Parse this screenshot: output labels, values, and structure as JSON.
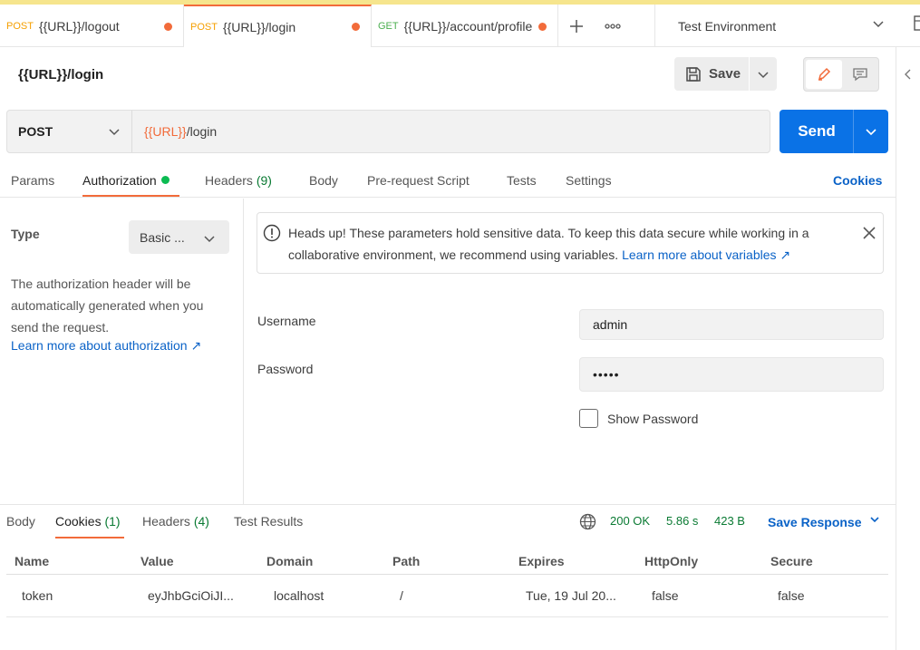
{
  "tabs": [
    {
      "method": "POST",
      "title": "{{URL}}/logout",
      "active": false
    },
    {
      "method": "POST",
      "title": "{{URL}}/login",
      "active": true
    },
    {
      "method": "GET",
      "title": "{{URL}}/account/profile",
      "active": false
    }
  ],
  "tab_add_icon": "plus-icon",
  "tab_more_icon": "ellipsis-icon",
  "environment": {
    "selected": "Test Environment"
  },
  "request": {
    "title": "{{URL}}/login",
    "save_label": "Save",
    "method": "POST",
    "url_var": "{{URL}}",
    "url_path": "/login",
    "send_label": "Send"
  },
  "req_tabs": {
    "params": "Params",
    "authorization": "Authorization",
    "headers": "Headers",
    "headers_count": "(9)",
    "body": "Body",
    "prerequest": "Pre-request Script",
    "tests": "Tests",
    "settings": "Settings",
    "cookies": "Cookies"
  },
  "auth": {
    "type_label": "Type",
    "type_value": "Basic ...",
    "description": "The authorization header will be automatically generated when you send the request.",
    "learn_more": "Learn more about authorization ↗",
    "alert_text": "Heads up! These parameters hold sensitive data. To keep this data secure while working in a collaborative environment, we recommend using variables.",
    "alert_link": "Learn more about variables ↗",
    "username_label": "Username",
    "username_value": "admin",
    "password_label": "Password",
    "password_value": "•••••",
    "show_password": "Show Password"
  },
  "response": {
    "tabs": {
      "body": "Body",
      "cookies": "Cookies",
      "cookies_count": "(1)",
      "headers": "Headers",
      "headers_count": "(4)",
      "tests": "Test Results"
    },
    "status": "200 OK",
    "time": "5.86 s",
    "size": "423 B",
    "save_response": "Save Response",
    "columns": [
      "Name",
      "Value",
      "Domain",
      "Path",
      "Expires",
      "HttpOnly",
      "Secure"
    ],
    "rows": [
      [
        "token",
        "eyJhbGciOiJI...",
        "localhost",
        "/",
        "Tue, 19 Jul 20...",
        "false",
        "false"
      ]
    ]
  },
  "colors": {
    "accent": "#f26b3a",
    "send": "#0a72e6",
    "link": "#0a62c7",
    "success": "#0a7a33"
  }
}
